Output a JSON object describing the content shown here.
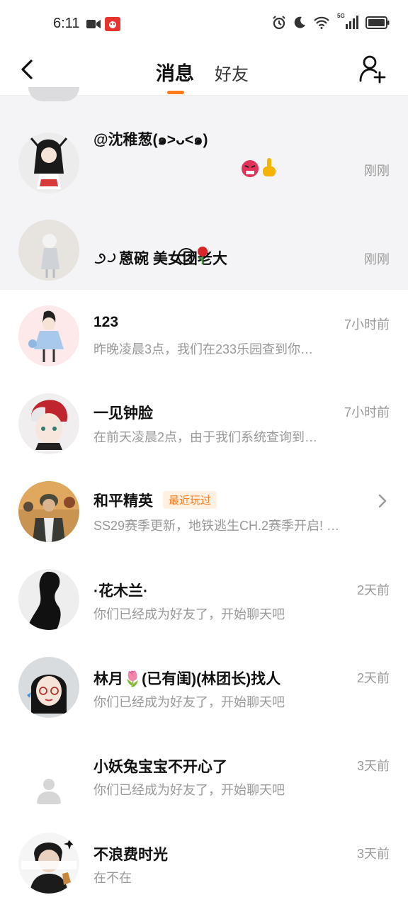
{
  "status_bar": {
    "time": "6:11",
    "network": "5G"
  },
  "nav": {
    "tab_messages": "消息",
    "tab_friends": "好友",
    "accent_color": "#ff7a1a"
  },
  "pinned": [
    {
      "name": "@沈稚葱(๑>ᴗ<๑)",
      "time": "刚刚"
    },
    {
      "name": "蒽碗  美女团老大",
      "time": "刚刚"
    }
  ],
  "conversations": [
    {
      "name": "123",
      "preview": "昨晚凌晨3点，我们在233乐园查到你…",
      "time": "7小时前"
    },
    {
      "name": "一见钟脸",
      "preview": "在前天凌晨2点，由于我们系统查询到…",
      "time": "7小时前"
    },
    {
      "name": "和平精英",
      "badge": "最近玩过",
      "preview": "SS29赛季更新，地铁逃生CH.2赛季开启! …"
    },
    {
      "name": "·花木兰·",
      "preview": "你们已经成为好友了，开始聊天吧",
      "time": "2天前"
    },
    {
      "name": "林月🌷(已有闺)(林团长)找人",
      "preview": "你们已经成为好友了，开始聊天吧",
      "time": "2天前"
    },
    {
      "name": "小妖兔宝宝不开心了",
      "preview": "你们已经成为好友了，开始聊天吧",
      "time": "3天前"
    },
    {
      "name": "不浪费时光",
      "preview": "在不在",
      "time": "3天前"
    }
  ]
}
